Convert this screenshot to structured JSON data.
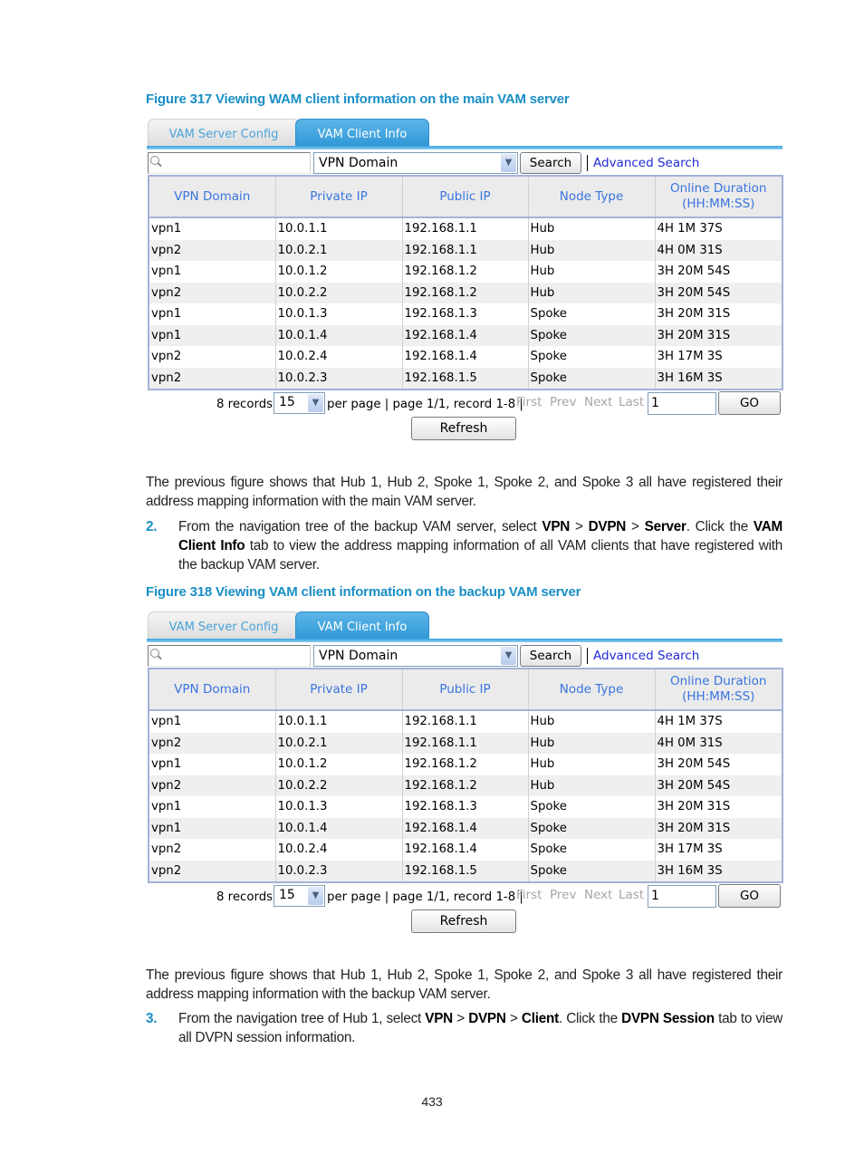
{
  "figure1": {
    "caption": "Figure 317 Viewing WAM client information on the main VAM server",
    "tabs": [
      {
        "label": "VAM Server Config",
        "active": false
      },
      {
        "label": "VAM Client Info",
        "active": true
      }
    ],
    "search": {
      "value": "",
      "field": "VPN Domain",
      "search_label": "Search",
      "advanced_label": "Advanced Search"
    },
    "columns": [
      "VPN Domain",
      "Private IP",
      "Public IP",
      "Node Type",
      "Online Duration (HH:MM:SS)"
    ],
    "column_header_lines": [
      [
        "VPN Domain"
      ],
      [
        "Private IP"
      ],
      [
        "Public IP"
      ],
      [
        "Node Type"
      ],
      [
        "Online Duration",
        "(HH:MM:SS)"
      ]
    ],
    "rows": [
      [
        "vpn1",
        "10.0.1.1",
        "192.168.1.1",
        "Hub",
        "4H 1M 37S"
      ],
      [
        "vpn2",
        "10.0.2.1",
        "192.168.1.1",
        "Hub",
        "4H 0M 31S"
      ],
      [
        "vpn1",
        "10.0.1.2",
        "192.168.1.2",
        "Hub",
        "3H 20M 54S"
      ],
      [
        "vpn2",
        "10.0.2.2",
        "192.168.1.2",
        "Hub",
        "3H 20M 54S"
      ],
      [
        "vpn1",
        "10.0.1.3",
        "192.168.1.3",
        "Spoke",
        "3H 20M 31S"
      ],
      [
        "vpn1",
        "10.0.1.4",
        "192.168.1.4",
        "Spoke",
        "3H 20M 31S"
      ],
      [
        "vpn2",
        "10.0.2.4",
        "192.168.1.4",
        "Spoke",
        "3H 17M 3S"
      ],
      [
        "vpn2",
        "10.0.2.3",
        "192.168.1.5",
        "Spoke",
        "3H 16M 3S"
      ]
    ],
    "pager": {
      "records": "8 records,",
      "per_page": "15",
      "info": "per page | page 1/1, record 1-8 |",
      "first": "First",
      "prev": "Prev",
      "next": "Next",
      "last": "Last",
      "page_input": "1",
      "go_label": "GO",
      "refresh_label": "Refresh"
    }
  },
  "para1": "The previous figure shows that Hub 1, Hub 2, Spoke 1, Spoke 2, and Spoke 3 all have registered their address mapping information with the main VAM server.",
  "step2": {
    "number": "2.",
    "parts": [
      {
        "t": "From the navigation tree of the backup VAM server, select ",
        "b": false
      },
      {
        "t": "VPN",
        "b": true
      },
      {
        "t": " > ",
        "b": false
      },
      {
        "t": "DVPN",
        "b": true
      },
      {
        "t": " > ",
        "b": false
      },
      {
        "t": "Server",
        "b": true
      },
      {
        "t": ". Click the ",
        "b": false
      },
      {
        "t": "VAM Client Info",
        "b": true
      },
      {
        "t": " tab to view the address mapping information of all VAM clients that have registered with the backup VAM server.",
        "b": false
      }
    ]
  },
  "figure2": {
    "caption": "Figure 318 Viewing VAM client information on the backup VAM server",
    "tabs": [
      {
        "label": "VAM Server Config",
        "active": false
      },
      {
        "label": "VAM Client Info",
        "active": true
      }
    ],
    "search": {
      "value": "",
      "field": "VPN Domain",
      "search_label": "Search",
      "advanced_label": "Advanced Search"
    },
    "columns": [
      "VPN Domain",
      "Private IP",
      "Public IP",
      "Node Type",
      "Online Duration (HH:MM:SS)"
    ],
    "column_header_lines": [
      [
        "VPN Domain"
      ],
      [
        "Private IP"
      ],
      [
        "Public IP"
      ],
      [
        "Node Type"
      ],
      [
        "Online Duration",
        "(HH:MM:SS)"
      ]
    ],
    "rows": [
      [
        "vpn1",
        "10.0.1.1",
        "192.168.1.1",
        "Hub",
        "4H 1M 37S"
      ],
      [
        "vpn2",
        "10.0.2.1",
        "192.168.1.1",
        "Hub",
        "4H 0M 31S"
      ],
      [
        "vpn1",
        "10.0.1.2",
        "192.168.1.2",
        "Hub",
        "3H 20M 54S"
      ],
      [
        "vpn2",
        "10.0.2.2",
        "192.168.1.2",
        "Hub",
        "3H 20M 54S"
      ],
      [
        "vpn1",
        "10.0.1.3",
        "192.168.1.3",
        "Spoke",
        "3H 20M 31S"
      ],
      [
        "vpn1",
        "10.0.1.4",
        "192.168.1.4",
        "Spoke",
        "3H 20M 31S"
      ],
      [
        "vpn2",
        "10.0.2.4",
        "192.168.1.4",
        "Spoke",
        "3H 17M 3S"
      ],
      [
        "vpn2",
        "10.0.2.3",
        "192.168.1.5",
        "Spoke",
        "3H 16M 3S"
      ]
    ],
    "pager": {
      "records": "8 records,",
      "per_page": "15",
      "info": "per page | page 1/1, record 1-8 |",
      "first": "First",
      "prev": "Prev",
      "next": "Next",
      "last": "Last",
      "page_input": "1",
      "go_label": "GO",
      "refresh_label": "Refresh"
    }
  },
  "para2": "The previous figure shows that Hub 1, Hub 2, Spoke 1, Spoke 2, and Spoke 3 all have registered their address mapping information with the backup VAM server.",
  "step3": {
    "number": "3.",
    "parts": [
      {
        "t": "From the navigation tree of Hub 1, select ",
        "b": false
      },
      {
        "t": "VPN",
        "b": true
      },
      {
        "t": " > ",
        "b": false
      },
      {
        "t": "DVPN",
        "b": true
      },
      {
        "t": " > ",
        "b": false
      },
      {
        "t": "Client",
        "b": true
      },
      {
        "t": ". Click the ",
        "b": false
      },
      {
        "t": "DVPN Session",
        "b": true
      },
      {
        "t": " tab to view all DVPN session information.",
        "b": false
      }
    ]
  },
  "page_number": "433",
  "colors": {
    "caption_blue": "#1a8fc6",
    "header_text": "#3a74e0",
    "link": "#1f2bd6",
    "tab_active": "#2d97d6",
    "disabled_nav": "#a6a6a6"
  }
}
